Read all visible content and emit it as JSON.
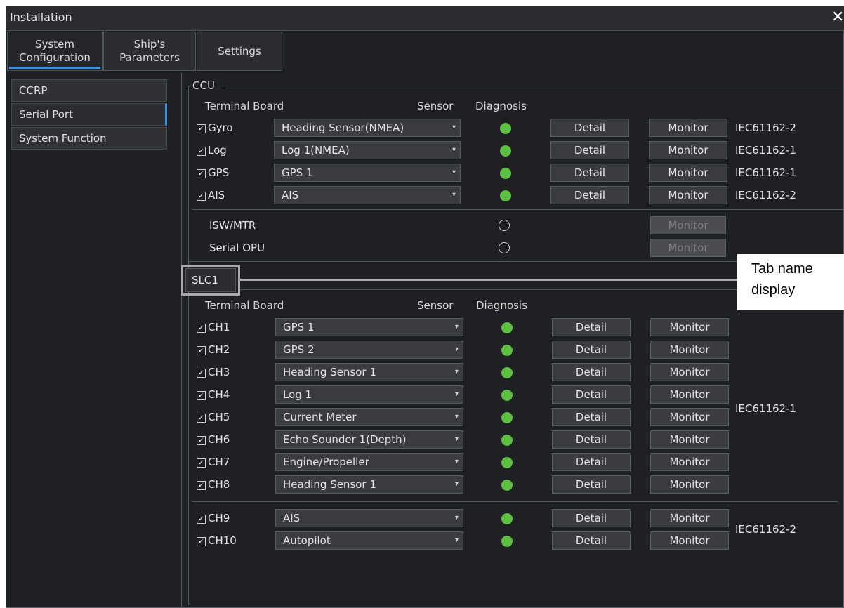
{
  "window": {
    "title": "Installation",
    "close_glyph": "✕"
  },
  "tabs": [
    {
      "line1": "System",
      "line2": "Configuration"
    },
    {
      "line1": "Ship's",
      "line2": "Parameters"
    },
    {
      "line1": "Settings",
      "line2": ""
    }
  ],
  "sidebar": {
    "items": [
      "CCRP",
      "Serial Port",
      "System Function"
    ]
  },
  "ccu": {
    "group_label": "CCU",
    "col_terminal": "Terminal Board",
    "col_sensor": "Sensor",
    "col_diagnosis": "Diagnosis",
    "rows": [
      {
        "name": "Gyro",
        "sensor": "Heading Sensor(NMEA)",
        "detail": "Detail",
        "monitor": "Monitor",
        "std": "IEC61162-2"
      },
      {
        "name": "Log",
        "sensor": "Log 1(NMEA)",
        "detail": "Detail",
        "monitor": "Monitor",
        "std": "IEC61162-1"
      },
      {
        "name": "GPS",
        "sensor": "GPS 1",
        "detail": "Detail",
        "monitor": "Monitor",
        "std": "IEC61162-1"
      },
      {
        "name": "AIS",
        "sensor": "AIS",
        "detail": "Detail",
        "monitor": "Monitor",
        "std": "IEC61162-2"
      }
    ],
    "extra_rows": [
      {
        "name": "ISW/MTR",
        "monitor": "Monitor"
      },
      {
        "name": "Serial OPU",
        "monitor": "Monitor"
      }
    ]
  },
  "slc": {
    "tab_label": "SLC1",
    "col_terminal": "Terminal Board",
    "col_sensor": "Sensor",
    "col_diagnosis": "Diagnosis",
    "rows": [
      {
        "name": "CH1",
        "sensor": "GPS 1",
        "detail": "Detail",
        "monitor": "Monitor"
      },
      {
        "name": "CH2",
        "sensor": "GPS 2",
        "detail": "Detail",
        "monitor": "Monitor"
      },
      {
        "name": "CH3",
        "sensor": "Heading Sensor 1",
        "detail": "Detail",
        "monitor": "Monitor"
      },
      {
        "name": "CH4",
        "sensor": "Log 1",
        "detail": "Detail",
        "monitor": "Monitor"
      },
      {
        "name": "CH5",
        "sensor": "Current Meter",
        "detail": "Detail",
        "monitor": "Monitor"
      },
      {
        "name": "CH6",
        "sensor": "Echo Sounder 1(Depth)",
        "detail": "Detail",
        "monitor": "Monitor"
      },
      {
        "name": "CH7",
        "sensor": "Engine/Propeller",
        "detail": "Detail",
        "monitor": "Monitor"
      },
      {
        "name": "CH8",
        "sensor": "Heading Sensor 1",
        "detail": "Detail",
        "monitor": "Monitor"
      },
      {
        "name": "CH9",
        "sensor": "AIS",
        "detail": "Detail",
        "monitor": "Monitor"
      },
      {
        "name": "CH10",
        "sensor": "Autopilot",
        "detail": "Detail",
        "monitor": "Monitor"
      }
    ],
    "std_group1": "IEC61162-1",
    "std_group2": "IEC61162-2"
  },
  "callout": {
    "line1": "Tab name",
    "line2": "display"
  },
  "colors": {
    "accent": "#3f8fe0",
    "led_on": "#5ec043",
    "background": "#1f2024"
  }
}
